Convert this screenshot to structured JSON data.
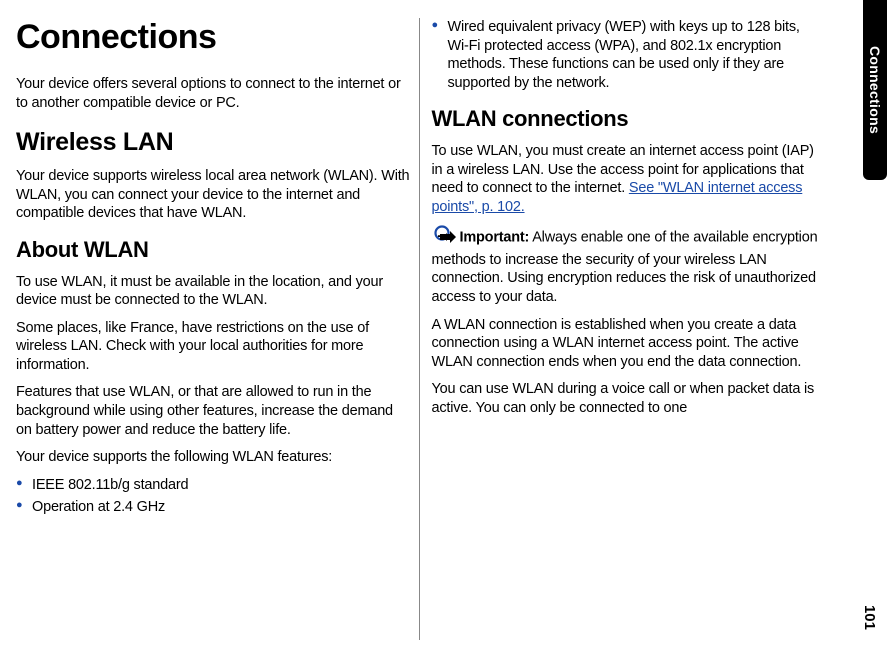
{
  "page_title": "Connections",
  "sidebar_label": "Connections",
  "page_number": "101",
  "left": {
    "intro": "Your device offers several options to connect to the internet or to another compatible device or PC.",
    "h2": "Wireless LAN",
    "wlan_intro": "Your device supports wireless local area network (WLAN). With WLAN, you can connect your device to the internet and compatible devices that have WLAN.",
    "h3": "About WLAN",
    "p1": "To use WLAN, it must be available in the location, and your device must be connected to the WLAN.",
    "p2": "Some places, like France, have restrictions on the use of wireless LAN. Check with your local authorities for more information.",
    "p3": "Features that use WLAN, or that are allowed to run in the background while using other features, increase the demand on battery power and reduce the battery life.",
    "p4": "Your device supports the following WLAN features:",
    "bullet1": "IEEE 802.11b/g standard",
    "bullet2": "Operation at 2.4 GHz"
  },
  "right": {
    "bullet3": "Wired equivalent privacy (WEP) with keys up to 128 bits, Wi-Fi protected access (WPA), and 802.1x encryption methods. These functions can be used only if they are supported by the network.",
    "h3": "WLAN connections",
    "p1_pre": "To use WLAN, you must create an internet access point (IAP) in a wireless LAN. Use the access point for applications that need to connect to the internet. ",
    "link_text": "See \"WLAN internet access points\", p. 102.",
    "important_label": "Important:",
    "important_text": "  Always enable one of the available encryption methods to increase the security of your wireless LAN connection. Using encryption reduces the risk of unauthorized access to your data.",
    "p3": "A WLAN connection is established when you create a data connection using a WLAN internet access point. The active WLAN connection ends when you end the data connection.",
    "p4": "You can use WLAN during a voice call or when packet data is active. You can only be connected to one"
  }
}
